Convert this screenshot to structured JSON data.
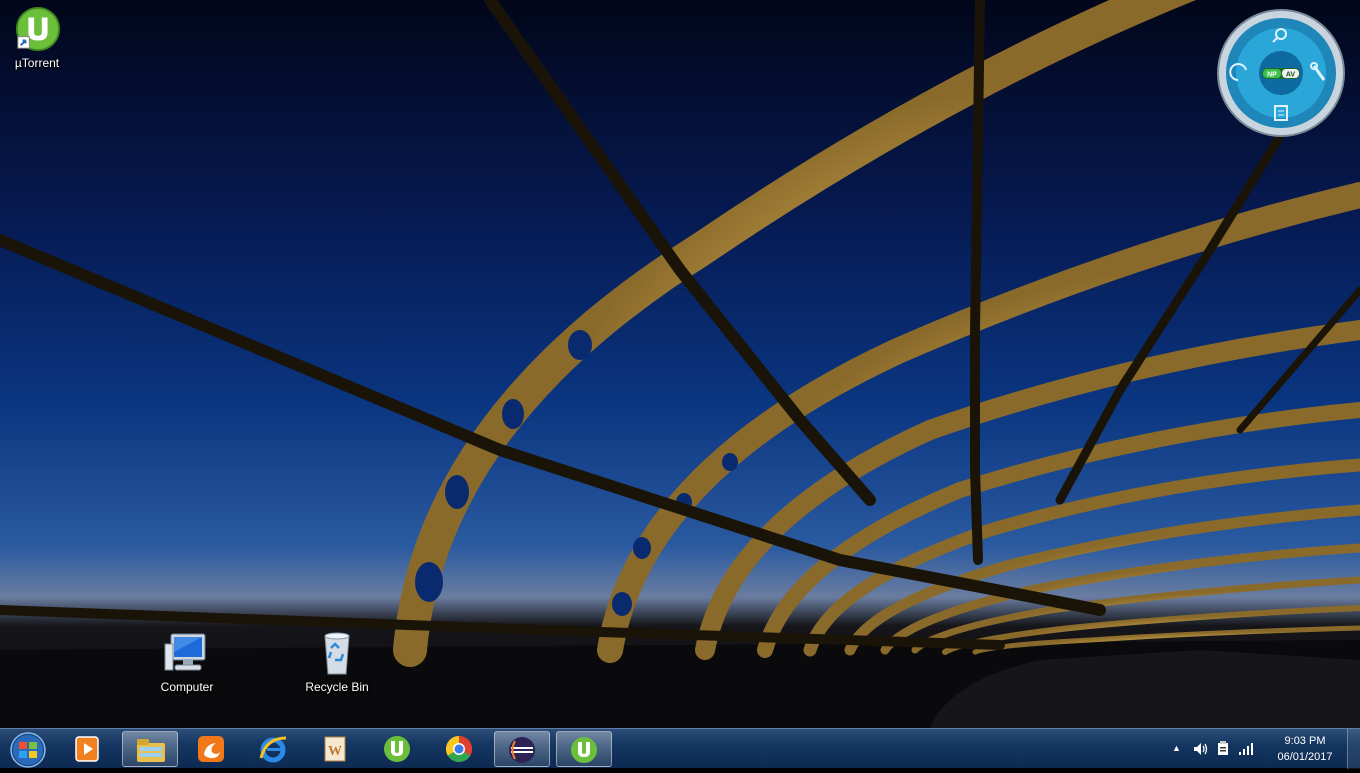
{
  "desktop": {
    "icons": [
      {
        "label": "µTorrent",
        "icon": "utorrent-icon"
      },
      {
        "label": "Computer",
        "icon": "computer-icon"
      },
      {
        "label": "Recycle Bin",
        "icon": "recycle-bin-icon"
      }
    ],
    "gadget": {
      "badge_left": "NP",
      "badge_right": "AV"
    }
  },
  "taskbar": {
    "start": "windows-start-orb",
    "pinned": [
      {
        "name": "media-player-icon",
        "active": false
      },
      {
        "name": "file-explorer-icon",
        "active": true
      },
      {
        "name": "uc-browser-icon",
        "active": false
      },
      {
        "name": "internet-explorer-icon",
        "active": false
      },
      {
        "name": "word-icon",
        "active": false
      },
      {
        "name": "utorrent-icon",
        "active": false
      },
      {
        "name": "chrome-icon",
        "active": false
      },
      {
        "name": "eclipse-icon",
        "active": true
      },
      {
        "name": "utorrent-window-icon",
        "active": true
      }
    ],
    "tray": {
      "icons": [
        "show-hidden-icons-arrow",
        "volume-icon",
        "action-center-icon",
        "network-signal-icon"
      ],
      "time": "9:03 PM",
      "date": "06/01/2017"
    }
  },
  "colors": {
    "taskbar": "#143660",
    "sky_top": "#02061a",
    "sky_mid": "#0a3580",
    "bridge": "#f2d27a"
  }
}
